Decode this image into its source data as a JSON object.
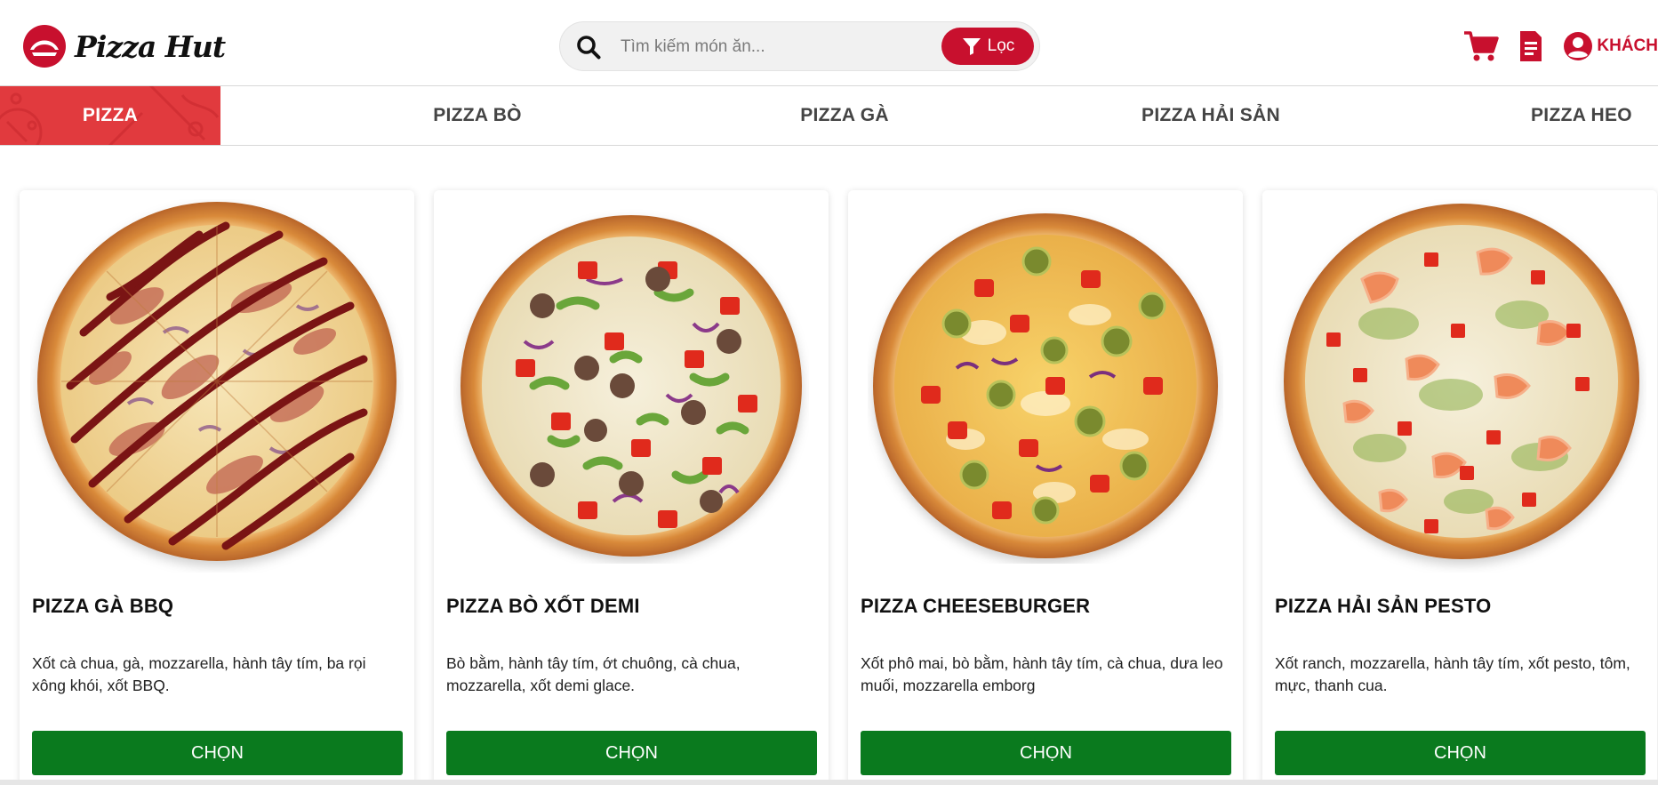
{
  "brand": {
    "name": "Pizza Hut",
    "accent": "#c8102e",
    "green": "#0a7a1e"
  },
  "search": {
    "placeholder": "Tìm kiếm món ăn...",
    "filter_label": "Lọc"
  },
  "account": {
    "label": "KHÁCH"
  },
  "categories": [
    {
      "label": "PIZZA",
      "active": true
    },
    {
      "label": "PIZZA BÒ",
      "active": false
    },
    {
      "label": "PIZZA GÀ",
      "active": false
    },
    {
      "label": "PIZZA HẢI SẢN",
      "active": false
    },
    {
      "label": "PIZZA HEO",
      "active": false
    }
  ],
  "products": [
    {
      "name": "PIZZA GÀ BBQ",
      "description": "Xốt cà chua, gà, mozzarella, hành tây tím, ba rọi xông khói, xốt BBQ.",
      "button": "CHỌN"
    },
    {
      "name": "PIZZA BÒ XỐT DEMI",
      "description": "Bò bằm, hành tây tím, ớt chuông, cà chua, mozzarella, xốt demi glace.",
      "button": "CHỌN"
    },
    {
      "name": "PIZZA CHEESEBURGER",
      "description": "Xốt phô mai, bò bằm, hành tây tím, cà chua, dưa leo muối, mozzarella emborg",
      "button": "CHỌN"
    },
    {
      "name": "PIZZA HẢI SẢN PESTO",
      "description": "Xốt ranch, mozzarella, hành tây tím, xốt pesto, tôm, mực, thanh cua.",
      "button": "CHỌN"
    }
  ]
}
